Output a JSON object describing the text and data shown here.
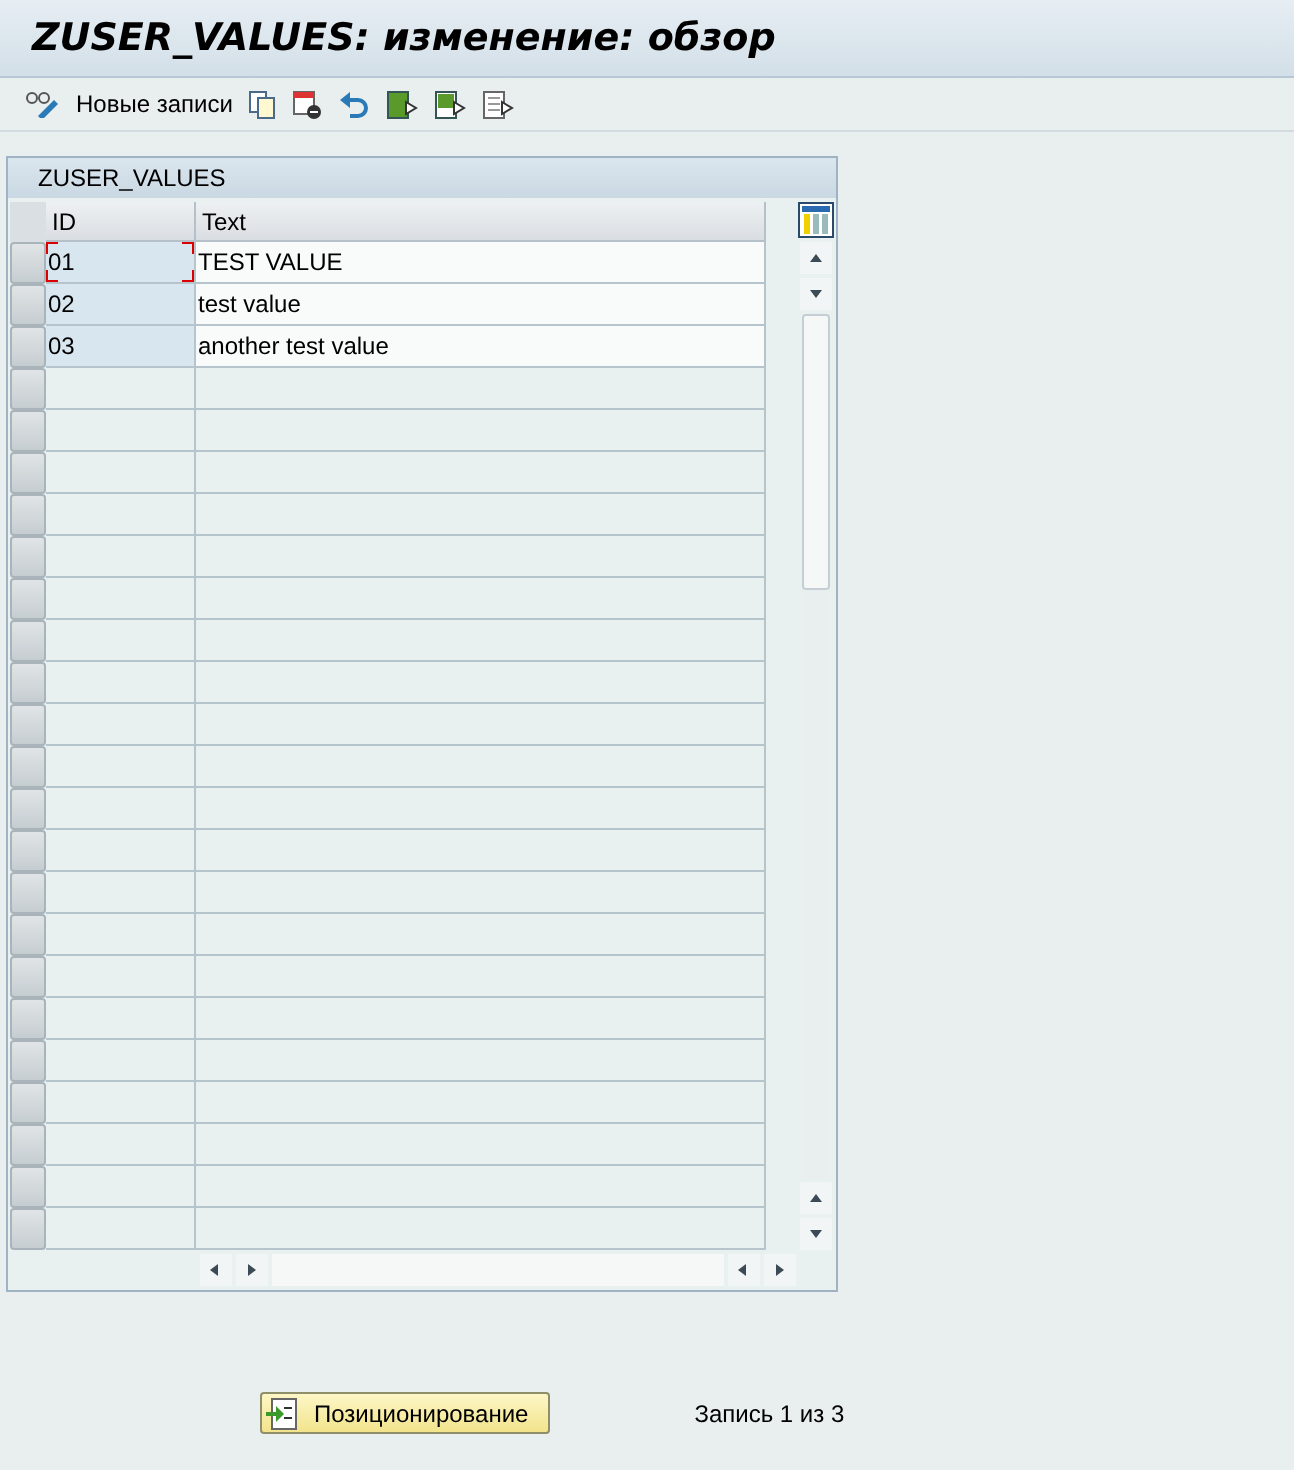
{
  "window": {
    "title": "ZUSER_VALUES: изменение: обзор"
  },
  "toolbar": {
    "items": [
      {
        "kind": "glasses"
      },
      {
        "kind": "label",
        "label": "Новые записи"
      },
      {
        "kind": "copy"
      },
      {
        "kind": "delete"
      },
      {
        "kind": "undo"
      },
      {
        "kind": "select-all"
      },
      {
        "kind": "select-block"
      },
      {
        "kind": "deselect"
      }
    ]
  },
  "table": {
    "title": "ZUSER_VALUES",
    "columns": [
      "ID",
      "Text"
    ],
    "rows": [
      {
        "cells": [
          "01",
          "TEST VALUE"
        ],
        "focused": true
      },
      {
        "cells": [
          "02",
          "test value"
        ],
        "focused": false
      },
      {
        "cells": [
          "03",
          "another test value"
        ],
        "focused": false
      }
    ]
  },
  "footer": {
    "button": "Позиционирование",
    "status": "Запись 1 из 3"
  }
}
